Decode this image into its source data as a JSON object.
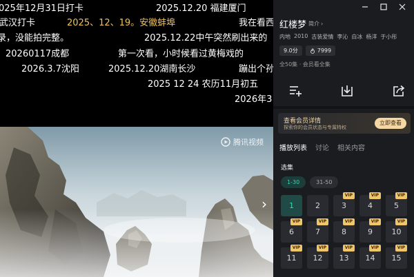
{
  "player": {
    "danmaku": [
      {
        "text": "025年12月31日打卡",
        "gold": false
      },
      {
        "text": "2025.12.20 福建厦门",
        "gold": false
      },
      {
        "text": "武汉打卡",
        "gold": false
      },
      {
        "text": "2025、12、19。安徽蚌埠",
        "gold": true
      },
      {
        "text": "我在看西",
        "gold": false
      },
      {
        "text": "录，没能拍完整。",
        "gold": false
      },
      {
        "text": "2025.12.22中午突然刷出来的",
        "gold": false
      },
      {
        "text": "20260117成都",
        "gold": false
      },
      {
        "text": "第一次看，小时候看过黄梅戏的",
        "gold": false
      },
      {
        "text": "2026.3.7沈阳",
        "gold": false
      },
      {
        "text": "2025.12.20湖南长沙",
        "gold": false
      },
      {
        "text": "蹦出个孙",
        "gold": false
      },
      {
        "text": "2025 12 24 农历11月初五",
        "gold": false
      },
      {
        "text": "2026年3",
        "gold": false
      }
    ],
    "watermark_text": "腾讯视频",
    "next_icon": "chevron-right-icon"
  },
  "window": {
    "controls": [
      "minimize-icon",
      "maximize-icon",
      "close-icon"
    ]
  },
  "show": {
    "title": "红楼梦",
    "intro_label": "简介",
    "tags": [
      "内地",
      "2010",
      "古装爱情",
      "李沁",
      "白冰",
      "杨洋",
      "于小彤"
    ],
    "rating": "9.0分",
    "heat": "7999",
    "episode_info": "全50集 · 会员看全集"
  },
  "actions": [
    "playlist-add-icon",
    "download-icon",
    "share-icon"
  ],
  "vip": {
    "title": "查看会员详情",
    "desc": "探索你的会员状态与专属特权",
    "button": "立即查看"
  },
  "tabs": [
    {
      "label": "播放列表",
      "active": true
    },
    {
      "label": "讨论",
      "active": false
    },
    {
      "label": "相关内容",
      "active": false
    }
  ],
  "episodes": {
    "section_label": "选集",
    "ranges": [
      {
        "label": "1-30",
        "active": true
      },
      {
        "label": "31-50",
        "active": false
      }
    ],
    "vip_badge": "VIP",
    "items": [
      {
        "num": "1",
        "vip": false,
        "current": true
      },
      {
        "num": "2",
        "vip": false,
        "current": false
      },
      {
        "num": "3",
        "vip": true,
        "current": false
      },
      {
        "num": "4",
        "vip": true,
        "current": false
      },
      {
        "num": "5",
        "vip": true,
        "current": false
      },
      {
        "num": "6",
        "vip": true,
        "current": false
      },
      {
        "num": "7",
        "vip": true,
        "current": false
      },
      {
        "num": "8",
        "vip": true,
        "current": false
      },
      {
        "num": "9",
        "vip": true,
        "current": false
      },
      {
        "num": "10",
        "vip": true,
        "current": false
      },
      {
        "num": "11",
        "vip": true,
        "current": false
      },
      {
        "num": "12",
        "vip": true,
        "current": false
      },
      {
        "num": "13",
        "vip": true,
        "current": false
      },
      {
        "num": "14",
        "vip": true,
        "current": false
      },
      {
        "num": "15",
        "vip": true,
        "current": false
      }
    ]
  },
  "colors": {
    "accent": "#3bd6b4",
    "vip_gold": "#f0c66a",
    "danmaku_highlight": "#f2c35b",
    "panel_bg": "#1b1c20"
  }
}
